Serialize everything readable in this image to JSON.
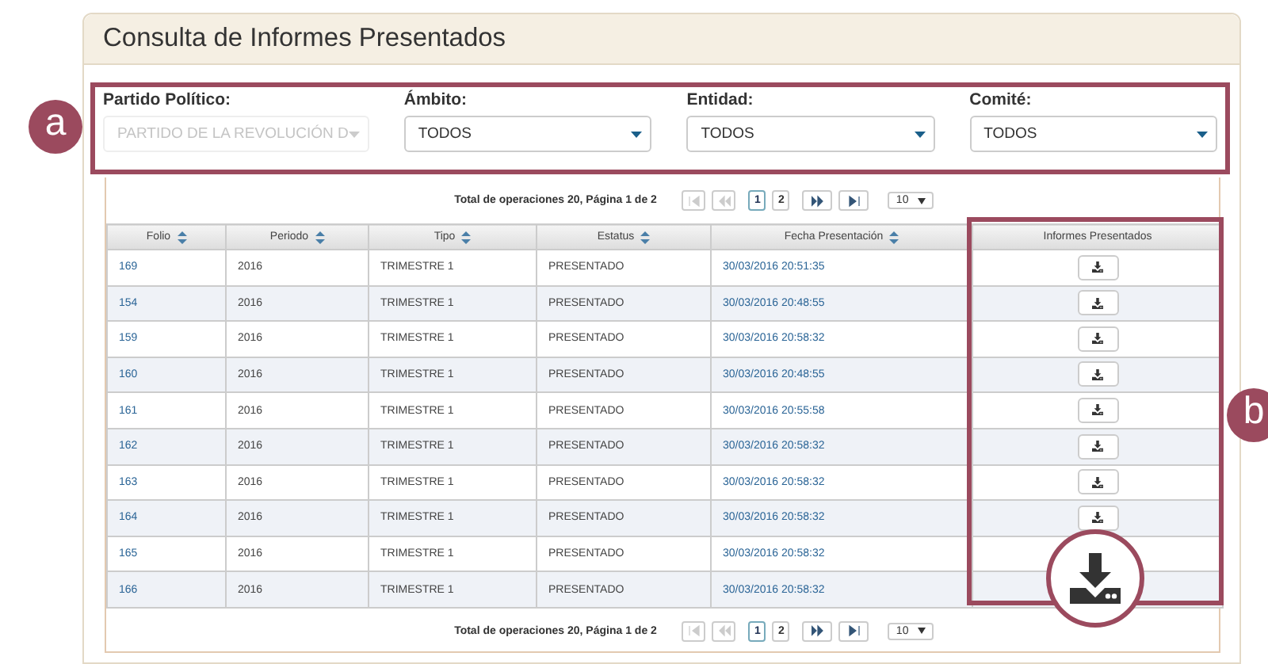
{
  "title": "Consulta de Informes Presentados",
  "filters": [
    {
      "label": "Partido Político:",
      "value": "PARTIDO DE LA REVOLUCIÓN D",
      "disabled": true
    },
    {
      "label": "Ámbito:",
      "value": "TODOS",
      "disabled": false
    },
    {
      "label": "Entidad:",
      "value": "TODOS",
      "disabled": false
    },
    {
      "label": "Comité:",
      "value": "TODOS",
      "disabled": false
    }
  ],
  "pagination": {
    "summary": "Total de operaciones 20, Página 1 de 2",
    "pages": [
      {
        "label": "1",
        "selected": true
      },
      {
        "label": "2",
        "selected": false
      }
    ],
    "page_size": "10"
  },
  "pagination_bottom": {
    "summary": "Total de operaciones 20, Página 1 de 2",
    "pages": [
      {
        "label": "1",
        "selected": true
      },
      {
        "label": "2",
        "selected": false
      }
    ],
    "page_size": "10"
  },
  "table": {
    "columns": [
      {
        "label": "Folio",
        "sortable": true
      },
      {
        "label": "Periodo",
        "sortable": true
      },
      {
        "label": "Tipo",
        "sortable": true
      },
      {
        "label": "Estatus",
        "sortable": true
      },
      {
        "label": "Fecha Presentación",
        "sortable": true
      },
      {
        "label": "Informes Presentados",
        "sortable": false
      }
    ],
    "rows": [
      {
        "folio": "169",
        "periodo": "2016",
        "tipo": "TRIMESTRE 1",
        "estatus": "PRESENTADO",
        "fecha": "30/03/2016 20:51:35",
        "download_button": true
      },
      {
        "folio": "154",
        "periodo": "2016",
        "tipo": "TRIMESTRE 1",
        "estatus": "PRESENTADO",
        "fecha": "30/03/2016 20:48:55",
        "download_button": true
      },
      {
        "folio": "159",
        "periodo": "2016",
        "tipo": "TRIMESTRE 1",
        "estatus": "PRESENTADO",
        "fecha": "30/03/2016 20:58:32",
        "download_button": true
      },
      {
        "folio": "160",
        "periodo": "2016",
        "tipo": "TRIMESTRE 1",
        "estatus": "PRESENTADO",
        "fecha": "30/03/2016 20:48:55",
        "download_button": true
      },
      {
        "folio": "161",
        "periodo": "2016",
        "tipo": "TRIMESTRE 1",
        "estatus": "PRESENTADO",
        "fecha": "30/03/2016 20:55:58",
        "download_button": true
      },
      {
        "folio": "162",
        "periodo": "2016",
        "tipo": "TRIMESTRE 1",
        "estatus": "PRESENTADO",
        "fecha": "30/03/2016 20:58:32",
        "download_button": true
      },
      {
        "folio": "163",
        "periodo": "2016",
        "tipo": "TRIMESTRE 1",
        "estatus": "PRESENTADO",
        "fecha": "30/03/2016 20:58:32",
        "download_button": true
      },
      {
        "folio": "164",
        "periodo": "2016",
        "tipo": "TRIMESTRE 1",
        "estatus": "PRESENTADO",
        "fecha": "30/03/2016 20:58:32",
        "download_button": true
      },
      {
        "folio": "165",
        "periodo": "2016",
        "tipo": "TRIMESTRE 1",
        "estatus": "PRESENTADO",
        "fecha": "30/03/2016 20:58:32",
        "download_button": false
      },
      {
        "folio": "166",
        "periodo": "2016",
        "tipo": "TRIMESTRE 1",
        "estatus": "PRESENTADO",
        "fecha": "30/03/2016 20:58:32",
        "download_button": false
      }
    ]
  },
  "callouts": [
    {
      "letter": "a"
    },
    {
      "letter": "b"
    }
  ]
}
